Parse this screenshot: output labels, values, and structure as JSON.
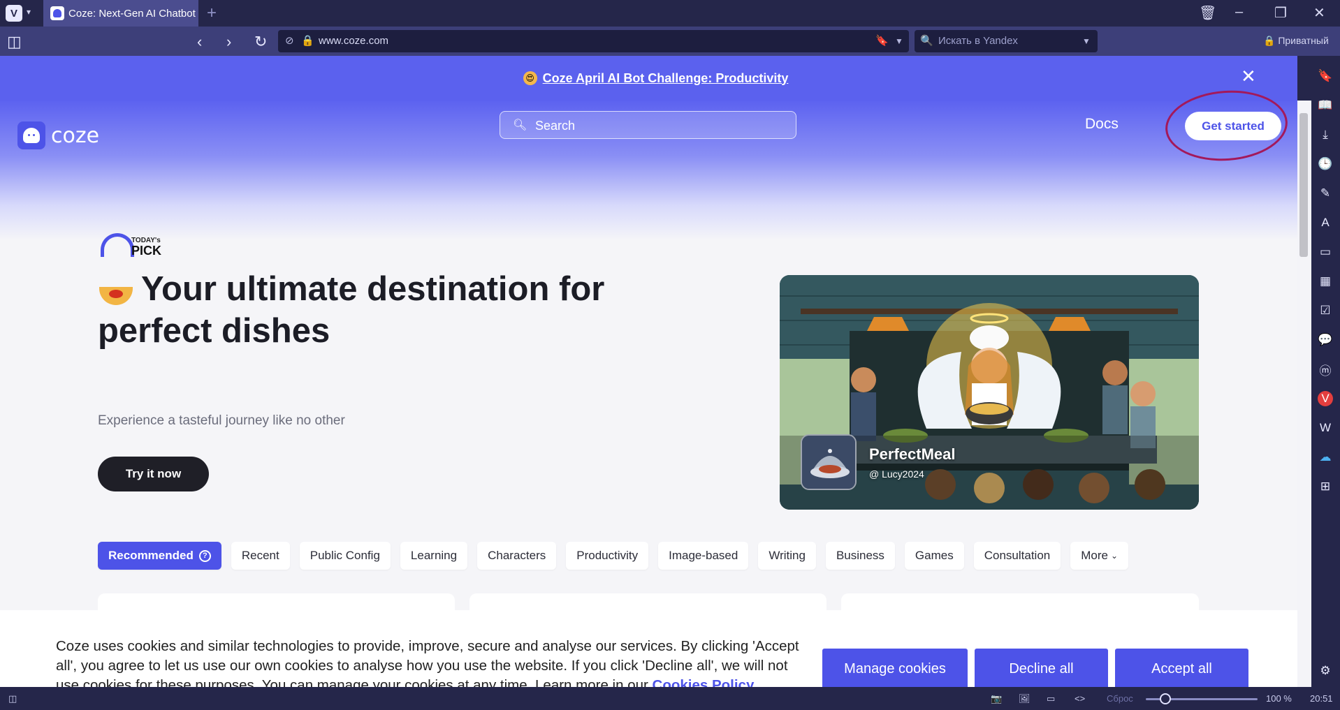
{
  "browser": {
    "tab_title": "Coze: Next-Gen AI Chatbot",
    "url": "www.coze.com",
    "search_placeholder": "Искать в Yandex",
    "private_label": "Приватный",
    "status": {
      "reset_label": "Сброс",
      "zoom": "100 %",
      "time": "20:51"
    }
  },
  "page": {
    "banner_text": "Coze April AI Bot Challenge: Productivity",
    "logo_text": "coze",
    "search_placeholder": "Search",
    "docs_label": "Docs",
    "get_started_label": "Get started",
    "hero": {
      "badge_small": "TODAY's",
      "badge_big": "PICK",
      "title": "Your ultimate destination for perfect dishes",
      "subtitle": "Experience a tasteful journey like no other",
      "cta_label": "Try it now"
    },
    "featured": {
      "name": "PerfectMeal",
      "author": "Lucy2024"
    },
    "categories": [
      "Recommended",
      "Recent",
      "Public Config",
      "Learning",
      "Characters",
      "Productivity",
      "Image-based",
      "Writing",
      "Business",
      "Games",
      "Consultation",
      "More"
    ],
    "cookie": {
      "text": "Coze uses cookies and similar technologies to provide, improve, secure and analyse our services. By clicking 'Accept all', you agree to let us use our own cookies to analyse how you use the website. If you click 'Decline all', we will not use cookies for these purposes. You can manage your cookies at any time. Learn more in our",
      "link_text": "Cookies Policy",
      "manage_label": "Manage cookies",
      "decline_label": "Decline all",
      "accept_label": "Accept all"
    }
  },
  "colors": {
    "brand": "#4d53e8",
    "chrome": "#25264a",
    "annotation": "#a3195b"
  }
}
